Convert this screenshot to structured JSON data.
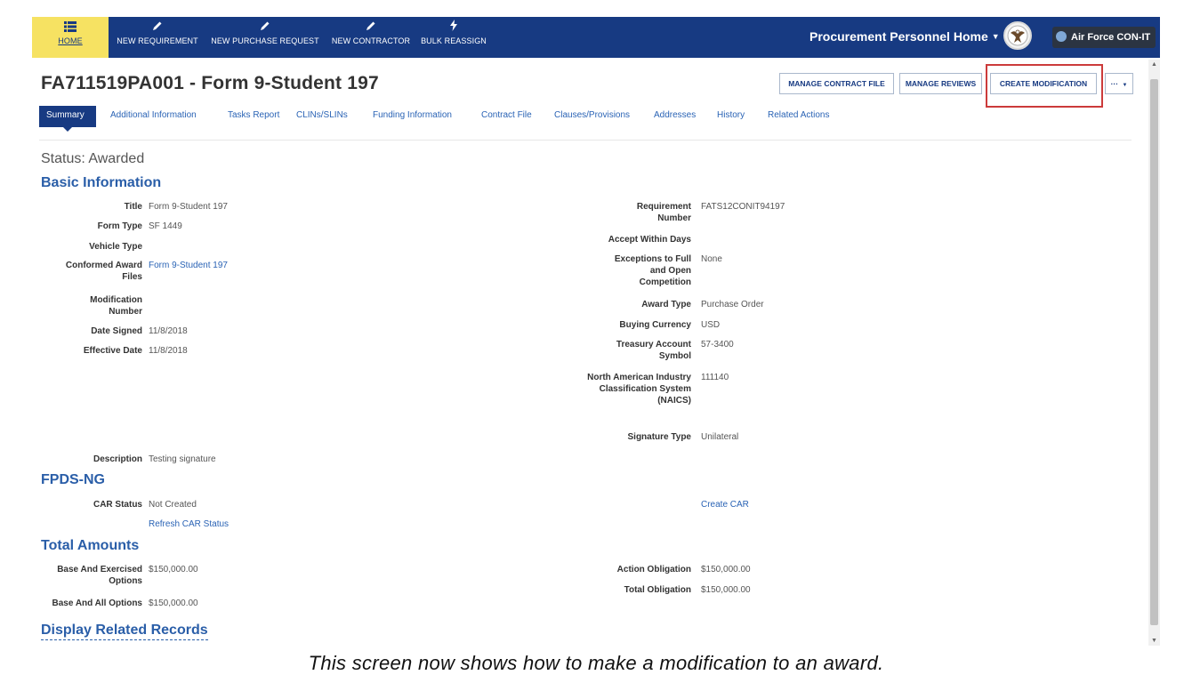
{
  "nav": {
    "home": {
      "label": "HOME",
      "icon": "list-icon"
    },
    "items": [
      {
        "label": "NEW REQUIREMENT",
        "icon": "pencil-icon"
      },
      {
        "label": "NEW PURCHASE REQUEST",
        "icon": "pencil-icon"
      },
      {
        "label": "NEW CONTRACTOR",
        "icon": "pencil-icon"
      },
      {
        "label": "BULK REASSIGN",
        "icon": "lightning-icon"
      }
    ],
    "portal": "Procurement Personnel Home",
    "org": "Air Force CON-IT"
  },
  "header": {
    "title": "FA711519PA001 - Form 9-Student 197",
    "buttons": {
      "manage_contract_file": "MANAGE CONTRACT FILE",
      "manage_reviews": "MANAGE REVIEWS",
      "create_modification": "CREATE MODIFICATION",
      "more": "···"
    }
  },
  "tabs": [
    "Summary",
    "Additional Information",
    "Tasks Report",
    "CLINs/SLINs",
    "Funding Information",
    "Contract File",
    "Clauses/Provisions",
    "Addresses",
    "History",
    "Related Actions"
  ],
  "status": "Status: Awarded",
  "basic": {
    "heading": "Basic Information",
    "left": [
      {
        "label": "Title",
        "value": "Form 9-Student 197"
      },
      {
        "label": "Form Type",
        "value": "SF 1449"
      },
      {
        "label": "Vehicle Type",
        "value": ""
      },
      {
        "label": "Conformed Award Files",
        "value": "Form 9-Student 197"
      },
      {
        "label": "Modification Number",
        "value": ""
      },
      {
        "label": "Date Signed",
        "value": "11/8/2018"
      },
      {
        "label": "Effective Date",
        "value": "11/8/2018"
      },
      {
        "label": "Description",
        "value": "Testing signature"
      }
    ],
    "right": [
      {
        "label": "Requirement Number",
        "value": "FATS12CONIT94197"
      },
      {
        "label": "Accept Within Days",
        "value": ""
      },
      {
        "label": "Exceptions to Full and Open Competition",
        "value": "None"
      },
      {
        "label": "Award Type",
        "value": "Purchase Order"
      },
      {
        "label": "Buying Currency",
        "value": "USD"
      },
      {
        "label": "Treasury Account Symbol",
        "value": "57-3400"
      },
      {
        "label": "North American Industry Classification System (NAICS)",
        "value": "111140"
      },
      {
        "label": "Signature Type",
        "value": "Unilateral"
      }
    ]
  },
  "fpds": {
    "heading": "FPDS-NG",
    "car_status_label": "CAR Status",
    "car_status_value": "Not Created",
    "refresh_link": "Refresh CAR Status",
    "create_car_link": "Create CAR"
  },
  "totals": {
    "heading": "Total Amounts",
    "left": [
      {
        "label": "Base And Exercised Options",
        "value": "$150,000.00"
      },
      {
        "label": "Base And All Options",
        "value": "$150,000.00"
      }
    ],
    "right": [
      {
        "label": "Action Obligation",
        "value": "$150,000.00"
      },
      {
        "label": "Total Obligation",
        "value": "$150,000.00"
      }
    ]
  },
  "related_link": "Display Related Records",
  "caption": "This screen now shows how to make a modification to an award."
}
